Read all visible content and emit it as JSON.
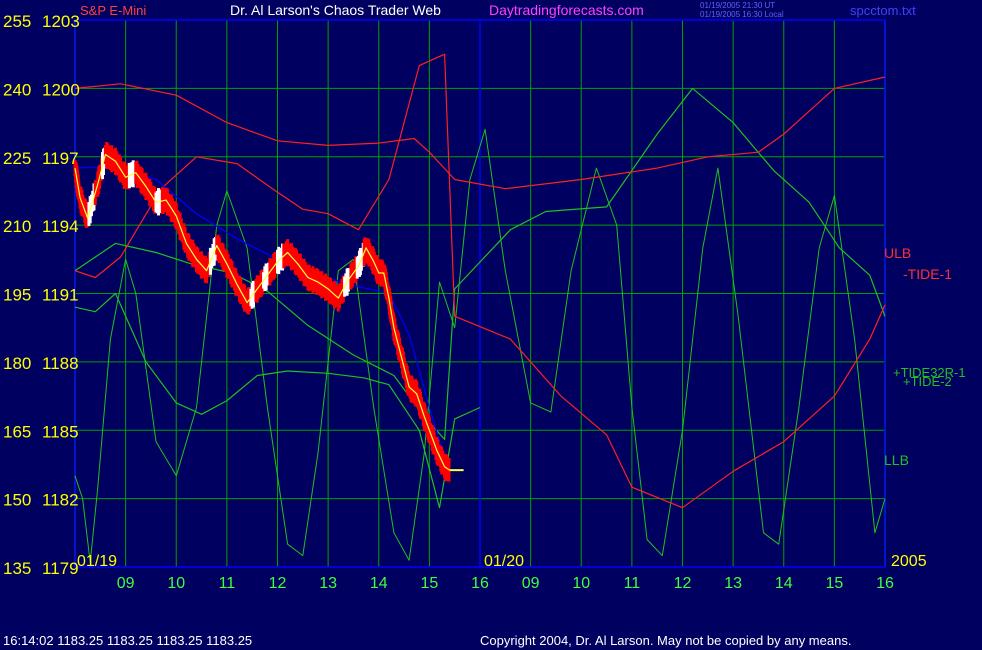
{
  "header": {
    "symbol": "S&P E-Mini",
    "title": "Dr. Al Larson's Chaos Trader Web",
    "site": "Daytradingforecasts.com",
    "time_ut": "01/19/2005 21:30 UT",
    "time_local": "01/19/2005 16:30 Local",
    "file": "spcctom.txt"
  },
  "footer": {
    "quote": "16:14:02  1183.25 1183.25 1183.25 1183.25",
    "copyright": "Copyright 2004, Dr. Al Larson. May not be copied by any means."
  },
  "colors": {
    "background": "#000060",
    "grid": "#00a000",
    "axis_left": "#ffff00",
    "price": "#ff0000",
    "price_up": "#ffffff",
    "ulb_llb": "#ff2020",
    "tide": "#20c020",
    "fractal": "#20c020",
    "blue_line": "#0000ff",
    "yellow_line": "#ffff40",
    "title": "#ffffff",
    "site": "#ff40ff",
    "symbol": "#ff4040",
    "file": "#4040ff",
    "hour_labels": "#40ff40"
  },
  "chart_data": {
    "type": "line",
    "y_axis_left_outer": [
      255,
      240,
      225,
      210,
      195,
      180,
      165,
      150,
      135
    ],
    "y_axis_left_inner": [
      1203,
      1200,
      1197,
      1194,
      1191,
      1188,
      1185,
      1182,
      1179
    ],
    "ylim_price": [
      1179,
      1203
    ],
    "x_hour_labels": [
      "09",
      "10",
      "11",
      "12",
      "13",
      "14",
      "15",
      "16",
      "09",
      "10",
      "11",
      "12",
      "13",
      "14",
      "15",
      "16"
    ],
    "date_labels": [
      "01/19",
      "01/20",
      "2005"
    ],
    "series_labels": [
      "ULB",
      "-TIDE-1",
      "+TIDE32R-1",
      "+TIDE-2",
      "LLB"
    ],
    "last_price": 1183.25,
    "price_path": [
      [
        0.0,
        1196.5
      ],
      [
        0.1,
        1195.2
      ],
      [
        0.25,
        1194.3
      ],
      [
        0.45,
        1195.8
      ],
      [
        0.6,
        1197.1
      ],
      [
        0.8,
        1196.8
      ],
      [
        1.0,
        1196.1
      ],
      [
        1.2,
        1196.3
      ],
      [
        1.4,
        1195.7
      ],
      [
        1.6,
        1195.0
      ],
      [
        1.8,
        1195.1
      ],
      [
        2.0,
        1194.4
      ],
      [
        2.2,
        1193.2
      ],
      [
        2.4,
        1192.5
      ],
      [
        2.6,
        1192.0
      ],
      [
        2.8,
        1193.1
      ],
      [
        3.0,
        1192.3
      ],
      [
        3.2,
        1191.4
      ],
      [
        3.4,
        1190.6
      ],
      [
        3.6,
        1191.2
      ],
      [
        3.8,
        1191.8
      ],
      [
        4.0,
        1192.4
      ],
      [
        4.2,
        1192.8
      ],
      [
        4.4,
        1192.3
      ],
      [
        4.6,
        1191.7
      ],
      [
        4.8,
        1191.5
      ],
      [
        5.0,
        1191.2
      ],
      [
        5.2,
        1190.8
      ],
      [
        5.4,
        1191.6
      ],
      [
        5.6,
        1192.2
      ],
      [
        5.75,
        1193.0
      ],
      [
        5.9,
        1192.4
      ],
      [
        6.0,
        1191.9
      ],
      [
        6.1,
        1191.9
      ],
      [
        6.2,
        1190.8
      ],
      [
        6.3,
        1189.5
      ],
      [
        6.45,
        1188.2
      ],
      [
        6.6,
        1186.9
      ],
      [
        6.75,
        1186.6
      ],
      [
        6.9,
        1185.6
      ],
      [
        7.0,
        1185.0
      ],
      [
        7.15,
        1184.1
      ],
      [
        7.3,
        1183.4
      ],
      [
        7.4,
        1183.25
      ]
    ],
    "ulb": [
      [
        0.0,
        1200.0
      ],
      [
        0.9,
        1200.2
      ],
      [
        2.0,
        1199.7
      ],
      [
        3.0,
        1198.5
      ],
      [
        4.0,
        1197.7
      ],
      [
        5.0,
        1197.5
      ],
      [
        6.0,
        1197.6
      ],
      [
        6.7,
        1197.8
      ],
      [
        7.0,
        1197.2
      ],
      [
        7.5,
        1196.0
      ],
      [
        8.5,
        1195.6
      ],
      [
        10.0,
        1196.0
      ],
      [
        11.5,
        1196.5
      ],
      [
        12.5,
        1197.0
      ],
      [
        13.5,
        1197.2
      ],
      [
        14.0,
        1198.0
      ],
      [
        15.0,
        1200.0
      ],
      [
        16.0,
        1200.5
      ]
    ],
    "llb": [
      [
        0.0,
        1192.0
      ],
      [
        0.4,
        1191.7
      ],
      [
        0.9,
        1192.6
      ],
      [
        1.7,
        1195.6
      ],
      [
        2.4,
        1197.0
      ],
      [
        3.2,
        1196.7
      ],
      [
        3.9,
        1195.6
      ],
      [
        4.5,
        1194.7
      ],
      [
        5.0,
        1194.5
      ],
      [
        5.6,
        1193.8
      ],
      [
        6.2,
        1196.0
      ],
      [
        6.8,
        1201.0
      ],
      [
        7.3,
        1201.5
      ],
      [
        7.5,
        1190.0
      ],
      [
        8.6,
        1189.0
      ],
      [
        9.6,
        1186.5
      ],
      [
        10.5,
        1184.8
      ],
      [
        11.0,
        1182.5
      ],
      [
        12.0,
        1181.6
      ],
      [
        13.0,
        1183.2
      ],
      [
        14.0,
        1184.5
      ],
      [
        15.0,
        1186.5
      ],
      [
        15.7,
        1189.0
      ],
      [
        16.0,
        1190.5
      ]
    ],
    "tide_1": [
      [
        0.0,
        1192.0
      ],
      [
        0.8,
        1193.2
      ],
      [
        1.6,
        1192.8
      ],
      [
        2.3,
        1192.3
      ],
      [
        3.1,
        1191.9
      ],
      [
        3.8,
        1191.1
      ],
      [
        4.6,
        1189.6
      ],
      [
        5.5,
        1188.3
      ],
      [
        6.3,
        1187.4
      ],
      [
        6.9,
        1185.6
      ],
      [
        7.3,
        1184.6
      ],
      [
        7.5,
        1191.2
      ],
      [
        8.6,
        1193.8
      ],
      [
        9.3,
        1194.6
      ],
      [
        10.5,
        1194.8
      ],
      [
        11.5,
        1198.0
      ],
      [
        12.2,
        1200.0
      ],
      [
        13.0,
        1198.5
      ],
      [
        13.8,
        1196.4
      ],
      [
        14.5,
        1195.0
      ],
      [
        15.1,
        1193.0
      ],
      [
        15.7,
        1191.8
      ],
      [
        16.0,
        1190.0
      ]
    ],
    "tide_2": [
      [
        0.0,
        1190.4
      ],
      [
        0.4,
        1190.2
      ],
      [
        0.8,
        1191.0
      ],
      [
        1.4,
        1188.0
      ],
      [
        2.0,
        1186.2
      ],
      [
        2.5,
        1185.7
      ],
      [
        3.0,
        1186.3
      ],
      [
        3.6,
        1187.4
      ],
      [
        4.2,
        1187.6
      ],
      [
        5.0,
        1187.5
      ],
      [
        5.7,
        1187.3
      ],
      [
        6.2,
        1187.0
      ],
      [
        6.8,
        1185.0
      ],
      [
        7.2,
        1181.6
      ],
      [
        7.5,
        1185.5
      ],
      [
        8.0,
        1186.0
      ]
    ],
    "fractal": [
      [
        0.0,
        1183.0
      ],
      [
        0.15,
        1182.0
      ],
      [
        0.3,
        1179.2
      ],
      [
        0.45,
        1182.5
      ],
      [
        0.7,
        1189.0
      ],
      [
        1.0,
        1192.5
      ],
      [
        1.2,
        1191.0
      ],
      [
        1.6,
        1184.5
      ],
      [
        2.0,
        1183.0
      ],
      [
        2.4,
        1186.0
      ],
      [
        2.8,
        1194.0
      ],
      [
        3.0,
        1195.5
      ],
      [
        3.4,
        1193.0
      ],
      [
        3.8,
        1186.0
      ],
      [
        4.2,
        1180.0
      ],
      [
        4.5,
        1179.5
      ],
      [
        4.8,
        1184.0
      ],
      [
        5.2,
        1192.0
      ],
      [
        5.5,
        1192.5
      ],
      [
        5.9,
        1186.0
      ],
      [
        6.3,
        1180.5
      ],
      [
        6.6,
        1179.3
      ],
      [
        6.9,
        1184.0
      ],
      [
        7.2,
        1191.5
      ],
      [
        7.5,
        1189.5
      ],
      [
        7.8,
        1196.0
      ],
      [
        8.1,
        1198.2
      ],
      [
        8.5,
        1192.0
      ],
      [
        9.0,
        1186.2
      ],
      [
        9.4,
        1185.8
      ],
      [
        9.8,
        1192.0
      ],
      [
        10.3,
        1196.5
      ],
      [
        10.7,
        1194.0
      ],
      [
        11.0,
        1186.0
      ],
      [
        11.3,
        1180.2
      ],
      [
        11.6,
        1179.5
      ],
      [
        12.0,
        1185.0
      ],
      [
        12.4,
        1193.0
      ],
      [
        12.7,
        1196.5
      ],
      [
        13.1,
        1190.0
      ],
      [
        13.6,
        1180.5
      ],
      [
        13.9,
        1180.0
      ],
      [
        14.3,
        1186.0
      ],
      [
        14.7,
        1193.0
      ],
      [
        15.0,
        1195.3
      ],
      [
        15.4,
        1189.0
      ],
      [
        15.8,
        1180.5
      ],
      [
        16.0,
        1182.0
      ]
    ],
    "blue_line": [
      [
        0.0,
        1196.5
      ],
      [
        0.8,
        1196.6
      ],
      [
        1.6,
        1196.0
      ],
      [
        2.4,
        1194.5
      ],
      [
        3.2,
        1193.4
      ],
      [
        4.0,
        1192.5
      ],
      [
        4.8,
        1191.8
      ],
      [
        5.6,
        1191.3
      ],
      [
        6.2,
        1191.0
      ],
      [
        6.6,
        1189.2
      ],
      [
        7.0,
        1186.0
      ],
      [
        7.3,
        1183.8
      ]
    ]
  }
}
